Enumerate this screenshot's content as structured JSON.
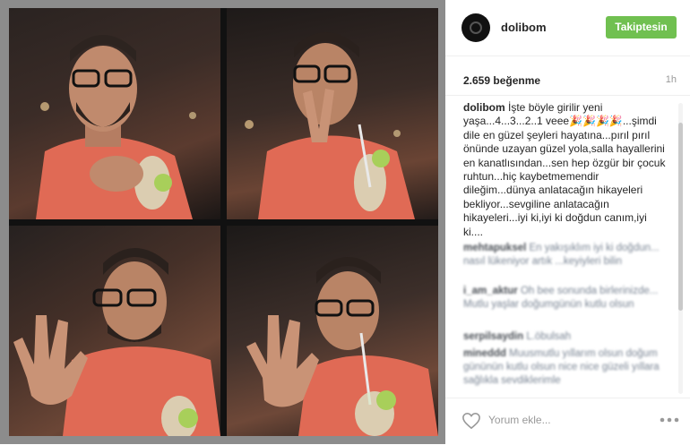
{
  "post": {
    "username": "dolibom",
    "follow_label": "Takiptesin",
    "likes": "2.659 beğenme",
    "time_ago": "1h",
    "caption_user": "dolibom",
    "caption_text": "İşte böyle girilir yeni yaşa...4...3...2..1 veee🎉🎉🎉🎉...şimdi dile en güzel şeyleri hayatına...pırıl pırıl önünde uzayan güzel yola,salla hayallerini en kanatlısından...sen hep özgür bir çocuk ruhtun...hiç kaybetmemendir dileğim...dünya anlatacağın hikayeleri bekliyor...sevgiline anlatacağın hikayeleri...iyi ki,iyi ki doğdun canım,iyi ki....",
    "comment_placeholder": "Yorum ekle..."
  },
  "comments": [
    {
      "user": "mehtapuksel",
      "text": "En yakışıklım iyi ki doğdun... nasıl lükeniyor artık ...keyiyleri bilin"
    },
    {
      "user": "i_am_aktur",
      "text": "Oh bee sonunda birlerinizde... Mutlu yaşlar doğumgünün kutlu olsun"
    },
    {
      "user": "serpilsaydin",
      "text": "L.öbulsah"
    },
    {
      "user": "mineddd",
      "text": "Muusmutlu yıllarım olsun doğum gününün kutlu olsun nice nice güzeli yıllara sağlıkla sevdiklerimle"
    }
  ],
  "icons": {
    "heart": "heart-icon",
    "more": "more-options-icon",
    "avatar": "avatar-icon"
  },
  "colors": {
    "follow_button": "#70c050",
    "text": "#262626",
    "muted": "#999999"
  }
}
